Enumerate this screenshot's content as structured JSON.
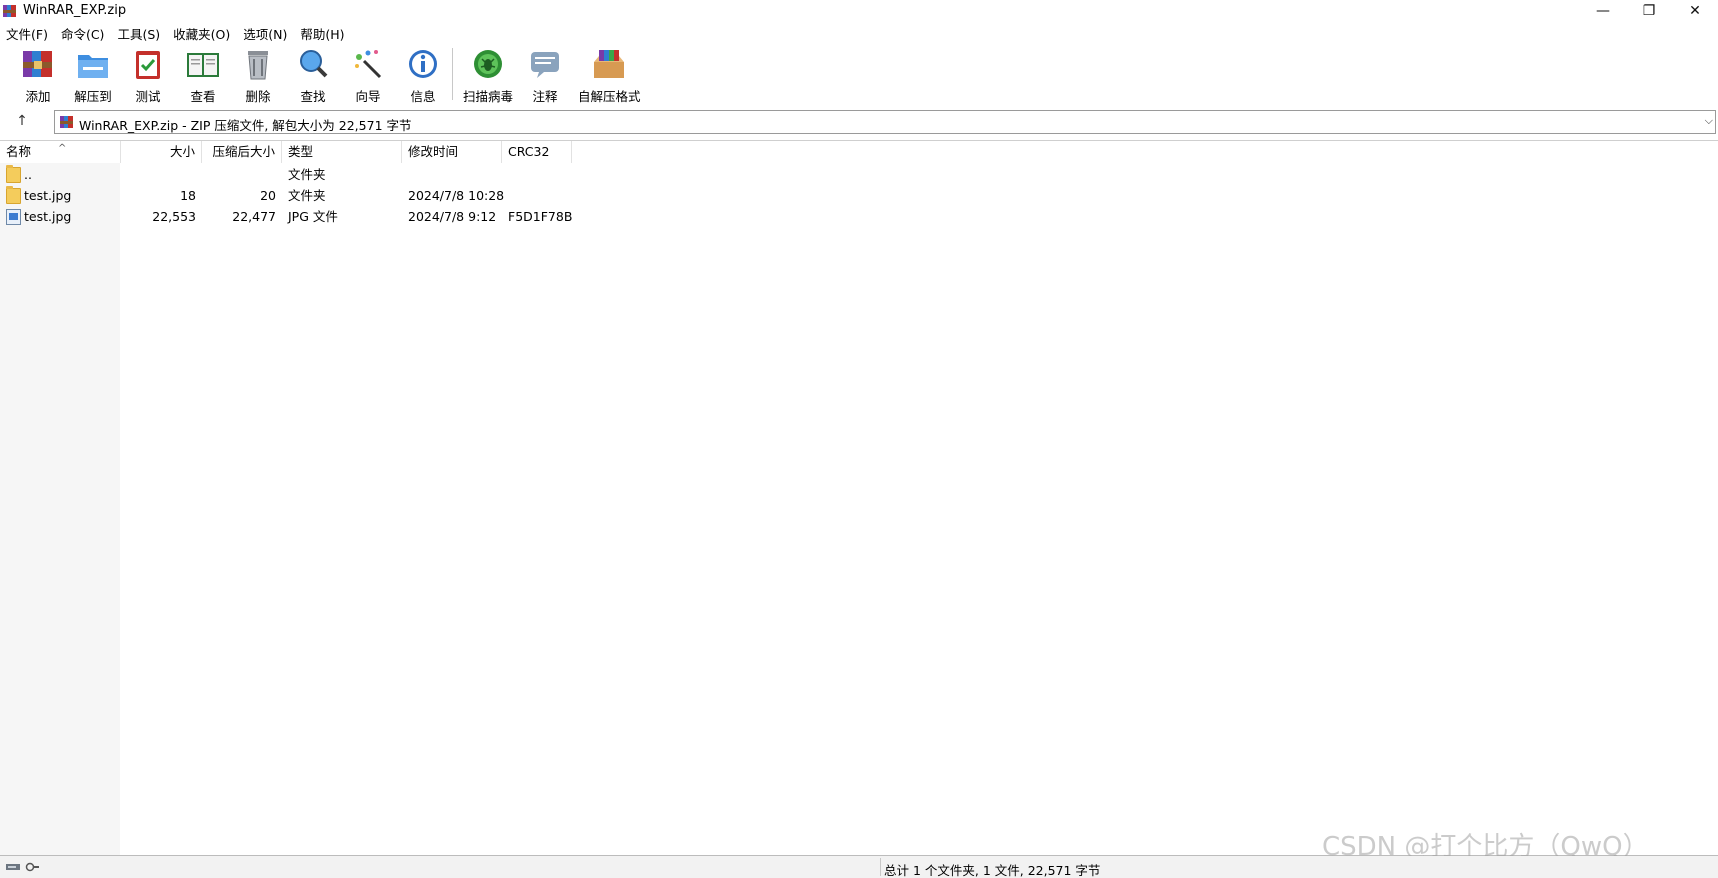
{
  "window": {
    "title": "WinRAR_EXP.zip",
    "controls": {
      "minimize": "—",
      "maximize": "❐",
      "close": "✕"
    }
  },
  "menu": [
    "文件(F)",
    "命令(C)",
    "工具(S)",
    "收藏夹(O)",
    "选项(N)",
    "帮助(H)"
  ],
  "toolbar": [
    {
      "label": "添加",
      "icon": "add-archive-icon"
    },
    {
      "label": "解压到",
      "icon": "extract-folder-icon"
    },
    {
      "label": "测试",
      "icon": "test-clipboard-icon"
    },
    {
      "label": "查看",
      "icon": "view-book-icon"
    },
    {
      "label": "删除",
      "icon": "trash-icon"
    },
    {
      "label": "查找",
      "icon": "magnifier-icon"
    },
    {
      "label": "向导",
      "icon": "wizard-wand-icon"
    },
    {
      "label": "信息",
      "icon": "info-icon"
    },
    {
      "label": "扫描病毒",
      "icon": "virus-scan-icon"
    },
    {
      "label": "注释",
      "icon": "comment-icon"
    },
    {
      "label": "自解压格式",
      "icon": "sfx-box-icon"
    }
  ],
  "address": {
    "up_symbol": "↑",
    "text": "WinRAR_EXP.zip - ZIP 压缩文件, 解包大小为 22,571 字节",
    "dropdown_symbol": "⌵"
  },
  "columns": [
    "名称",
    "大小",
    "压缩后大小",
    "类型",
    "修改时间",
    "CRC32"
  ],
  "sort_indicator": "^",
  "files": [
    {
      "name": "..",
      "size": "",
      "packed": "",
      "type": "文件夹",
      "modified": "",
      "crc": "",
      "kind": "folder"
    },
    {
      "name": "test.jpg",
      "size": "18",
      "packed": "20",
      "type": "文件夹",
      "modified": "2024/7/8 10:28",
      "crc": "",
      "kind": "folder"
    },
    {
      "name": "test.jpg",
      "size": "22,553",
      "packed": "22,477",
      "type": "JPG 文件",
      "modified": "2024/7/8 9:12",
      "crc": "F5D1F78B",
      "kind": "image"
    }
  ],
  "status": {
    "summary": "总计 1 个文件夹, 1 文件, 22,571 字节"
  },
  "watermark": "CSDN @打个比方（QwQ）",
  "colors": {
    "accent": "#3c7bd0",
    "folder": "#f4cc5c"
  }
}
